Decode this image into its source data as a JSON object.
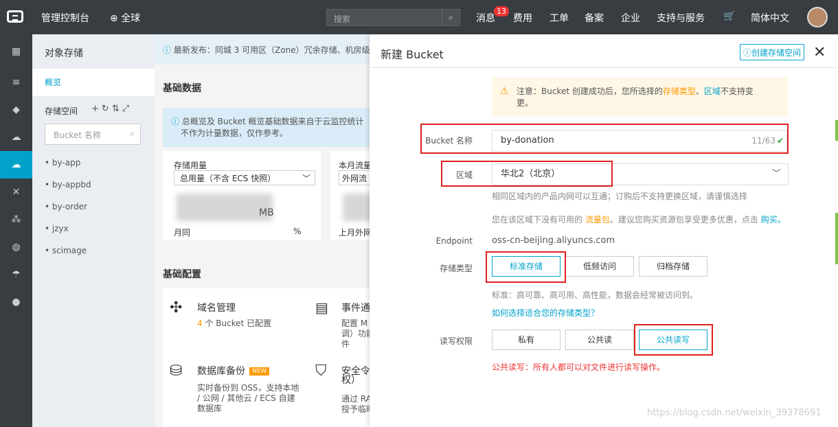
{
  "topbar": {
    "console": "管理控制台",
    "region": "全球",
    "search_placeholder": "搜索",
    "messages": "消息",
    "message_count": "13",
    "fees": "费用",
    "tickets": "工单",
    "record": "备案",
    "enterprise": "企业",
    "support": "支持与服务",
    "language": "简体中文"
  },
  "sidebar": {
    "title": "对象存储",
    "overview": "概览",
    "bucket_list_label": "存储空间",
    "bucket_search_placeholder": "Bucket 名称",
    "buckets": [
      "by-app",
      "by-appbd",
      "by-order",
      "jzyx",
      "scimage"
    ]
  },
  "main": {
    "notice": "最新发布：同城 3 可用区（Zone）冗余存储、机房级",
    "basic_data_title": "基础数据",
    "info_line1": "总概览及 Bucket 概览基础数据来自于云监控统计",
    "info_line2": "不作为计量数据，仅作参考。",
    "storage_usage_label": "存储用量",
    "storage_select": "总用量（不含 ECS 快照）",
    "monthly_traffic_label": "本月流量",
    "traffic_select": "外网流",
    "storage_unit": "MB",
    "storage_footer": "月同",
    "storage_pct": "%",
    "traffic_footer": "上月外网",
    "basic_config_title": "基础配置",
    "domain_mgmt": "域名管理",
    "domain_count": "4",
    "domain_configured": " 个 Bucket 已配置",
    "event_title": "事件通",
    "event_sub1": "配置 M",
    "event_sub2": "调）功能",
    "event_sub3": "件",
    "db_backup": "数据库备份",
    "new_tag": "NEW",
    "db_sub1": "实时备份到 OSS，支持本地",
    "db_sub2": "/ 公网 / 其他云 / ECS 自建",
    "db_sub3": "数据库",
    "security_title": "安全令",
    "security_sub0": "权）",
    "security_sub1": "通过 RA",
    "security_sub2": "授予临时"
  },
  "panel": {
    "title": "新建 Bucket",
    "create_link": "创建存储空间",
    "warning_prefix": "注意：Bucket 创建成功后，您所选择的",
    "warning_storage_type": "存储类型",
    "warning_sep": "、",
    "warning_region": "区域",
    "warning_suffix": "不支持变",
    "warning_line2": "更。",
    "bucket_name_label": "Bucket 名称",
    "bucket_name_value": "by-donation",
    "bucket_name_count": "11/63",
    "region_label": "区域",
    "region_value": "华北2（北京）",
    "region_hint": "相同区域内的产品内网可以互通；订购后不支持更换区域，请谨慎选择",
    "traffic_hint_prefix": "您在该区域下没有可用的",
    "traffic_pack": "流量包",
    "traffic_hint_mid": "。建议您购买资源包享受更多优惠，点击",
    "buy_link": "购买。",
    "endpoint_label": "Endpoint",
    "endpoint_value": "oss-cn-beijing.aliyuncs.com",
    "storage_type_label": "存储类型",
    "storage_types": [
      "标准存储",
      "低频访问",
      "归档存储"
    ],
    "storage_hint": "标准：高可靠、高可用、高性能，数据会经常被访问到。",
    "storage_help_link": "如何选择适合您的存储类型？",
    "acl_label": "读写权限",
    "acl_options": [
      "私有",
      "公共读",
      "公共读写"
    ],
    "acl_warning": "公共读写：所有人都可以对文件进行读写操作。"
  },
  "watermark": "https://blog.csdn.net/weixin_39378691"
}
